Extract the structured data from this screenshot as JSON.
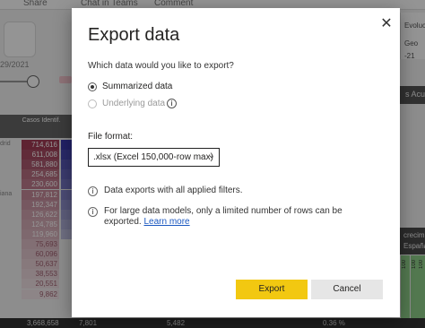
{
  "background": {
    "topbar": {
      "share": "Share",
      "chat": "Chat in Teams",
      "comment": "Comment"
    },
    "slicer_date": "29/2021",
    "table": {
      "header": "Casos Identif.",
      "row_labels": [
        "drid",
        "",
        "",
        "iana"
      ],
      "values": [
        "714,616",
        "611,008",
        "581,880",
        "254,685",
        "230,600",
        "197,812",
        "192,347",
        "126,622",
        "124,785",
        "119,960",
        "75,693",
        "60,096",
        "50,637",
        "38,553",
        "20,551",
        "9,862"
      ],
      "total": [
        "3,668,658",
        "7,801",
        "5,482",
        "0.36 %"
      ]
    },
    "right_panel": {
      "top_line1": "Evolución ac",
      "top_line2": "Geo",
      "top_line3": "-21",
      "dark_label": "s Acum",
      "mid_line1": "crecim",
      "mid_line2": "España",
      "bar_labels": [
        "100",
        "100",
        "100"
      ]
    }
  },
  "dialog": {
    "title": "Export data",
    "close_icon": "close-icon",
    "question": "Which data would you like to export?",
    "options": [
      {
        "label": "Summarized data",
        "selected": true,
        "enabled": true
      },
      {
        "label": "Underlying data",
        "selected": false,
        "enabled": false
      }
    ],
    "file_format_label": "File format:",
    "file_format_value": ".xlsx (Excel 150,000-row max)",
    "notes": {
      "note1": "Data exports with all applied filters.",
      "note2": "For large data models, only a limited number of rows can be exported.",
      "learn_more": "Learn more"
    },
    "export_label": "Export",
    "cancel_label": "Cancel",
    "colors": {
      "export_button": "#f2c811",
      "cancel_button": "#e6e6e6",
      "link": "#1a57c0"
    }
  }
}
